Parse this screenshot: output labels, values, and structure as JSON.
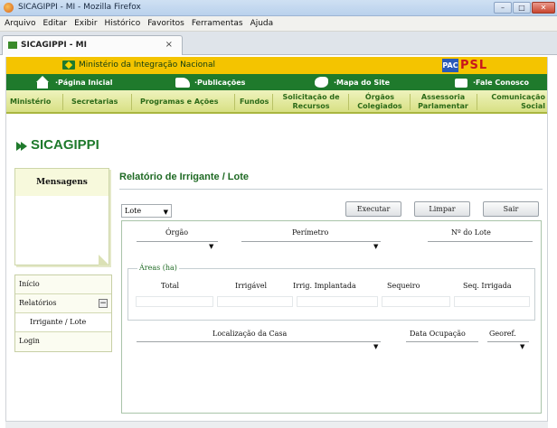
{
  "browser": {
    "window_title": "SICAGIPPI - MI - Mozilla Firefox",
    "window_buttons": [
      "–",
      "□",
      "✕"
    ],
    "menu": [
      "Arquivo",
      "Editar",
      "Exibir",
      "Histórico",
      "Favoritos",
      "Ferramentas",
      "Ajuda"
    ],
    "tab_label": "SICAGIPPI - MI",
    "tab_close": "×"
  },
  "header": {
    "ministry": "Ministério da Integração Nacional",
    "pac_badge": "PAC",
    "psl_logo": "PSL",
    "nav": [
      {
        "label": "·Página Inicial",
        "icon": "house-icon"
      },
      {
        "label": "·Publicações",
        "icon": "book-icon"
      },
      {
        "label": "·Mapa do Site",
        "icon": "map-icon"
      },
      {
        "label": "·Fale Conosco",
        "icon": "mail-icon"
      }
    ],
    "sections": [
      {
        "line1": "Ministério",
        "line2": ""
      },
      {
        "line1": "Secretarias",
        "line2": ""
      },
      {
        "line1": "Programas e Ações",
        "line2": ""
      },
      {
        "line1": "Fundos",
        "line2": ""
      },
      {
        "line1": "Solicitação de",
        "line2": "Recursos"
      },
      {
        "line1": "Órgãos",
        "line2": "Colegiados"
      },
      {
        "line1": "Assessoria",
        "line2": "Parlamentar"
      },
      {
        "line1": "Comunicação",
        "line2": "Social"
      }
    ]
  },
  "brand": {
    "name": "SICAGIPPI",
    "color": "#1f7a2c"
  },
  "sidebar": {
    "messages_title": "Mensagens",
    "menu": [
      {
        "label": "Início"
      },
      {
        "label": "Relatórios",
        "toggle": "−"
      },
      {
        "label": "Irrigante / Lote"
      },
      {
        "label": "Login"
      }
    ]
  },
  "main": {
    "title": "Relatório de Irrigante / Lote",
    "report_type": "Lote",
    "caret": "▼",
    "buttons": {
      "execute": "Executar",
      "clear": "Limpar",
      "exit": "Sair"
    },
    "fields": {
      "orgao": "Órgão",
      "perimetro": "Perímetro",
      "nr_lote": "Nº do Lote",
      "areas_legend": "Áreas (ha)",
      "total": "Total",
      "irrigavel": "Irrigável",
      "irrig_implantada": "Irrig. Implantada",
      "sequeiro": "Sequeiro",
      "seq_irrigada": "Seq. Irrigada",
      "localizacao_casa": "Localização da Casa",
      "data_ocupacao": "Data Ocupação",
      "georef": "Georef."
    }
  }
}
